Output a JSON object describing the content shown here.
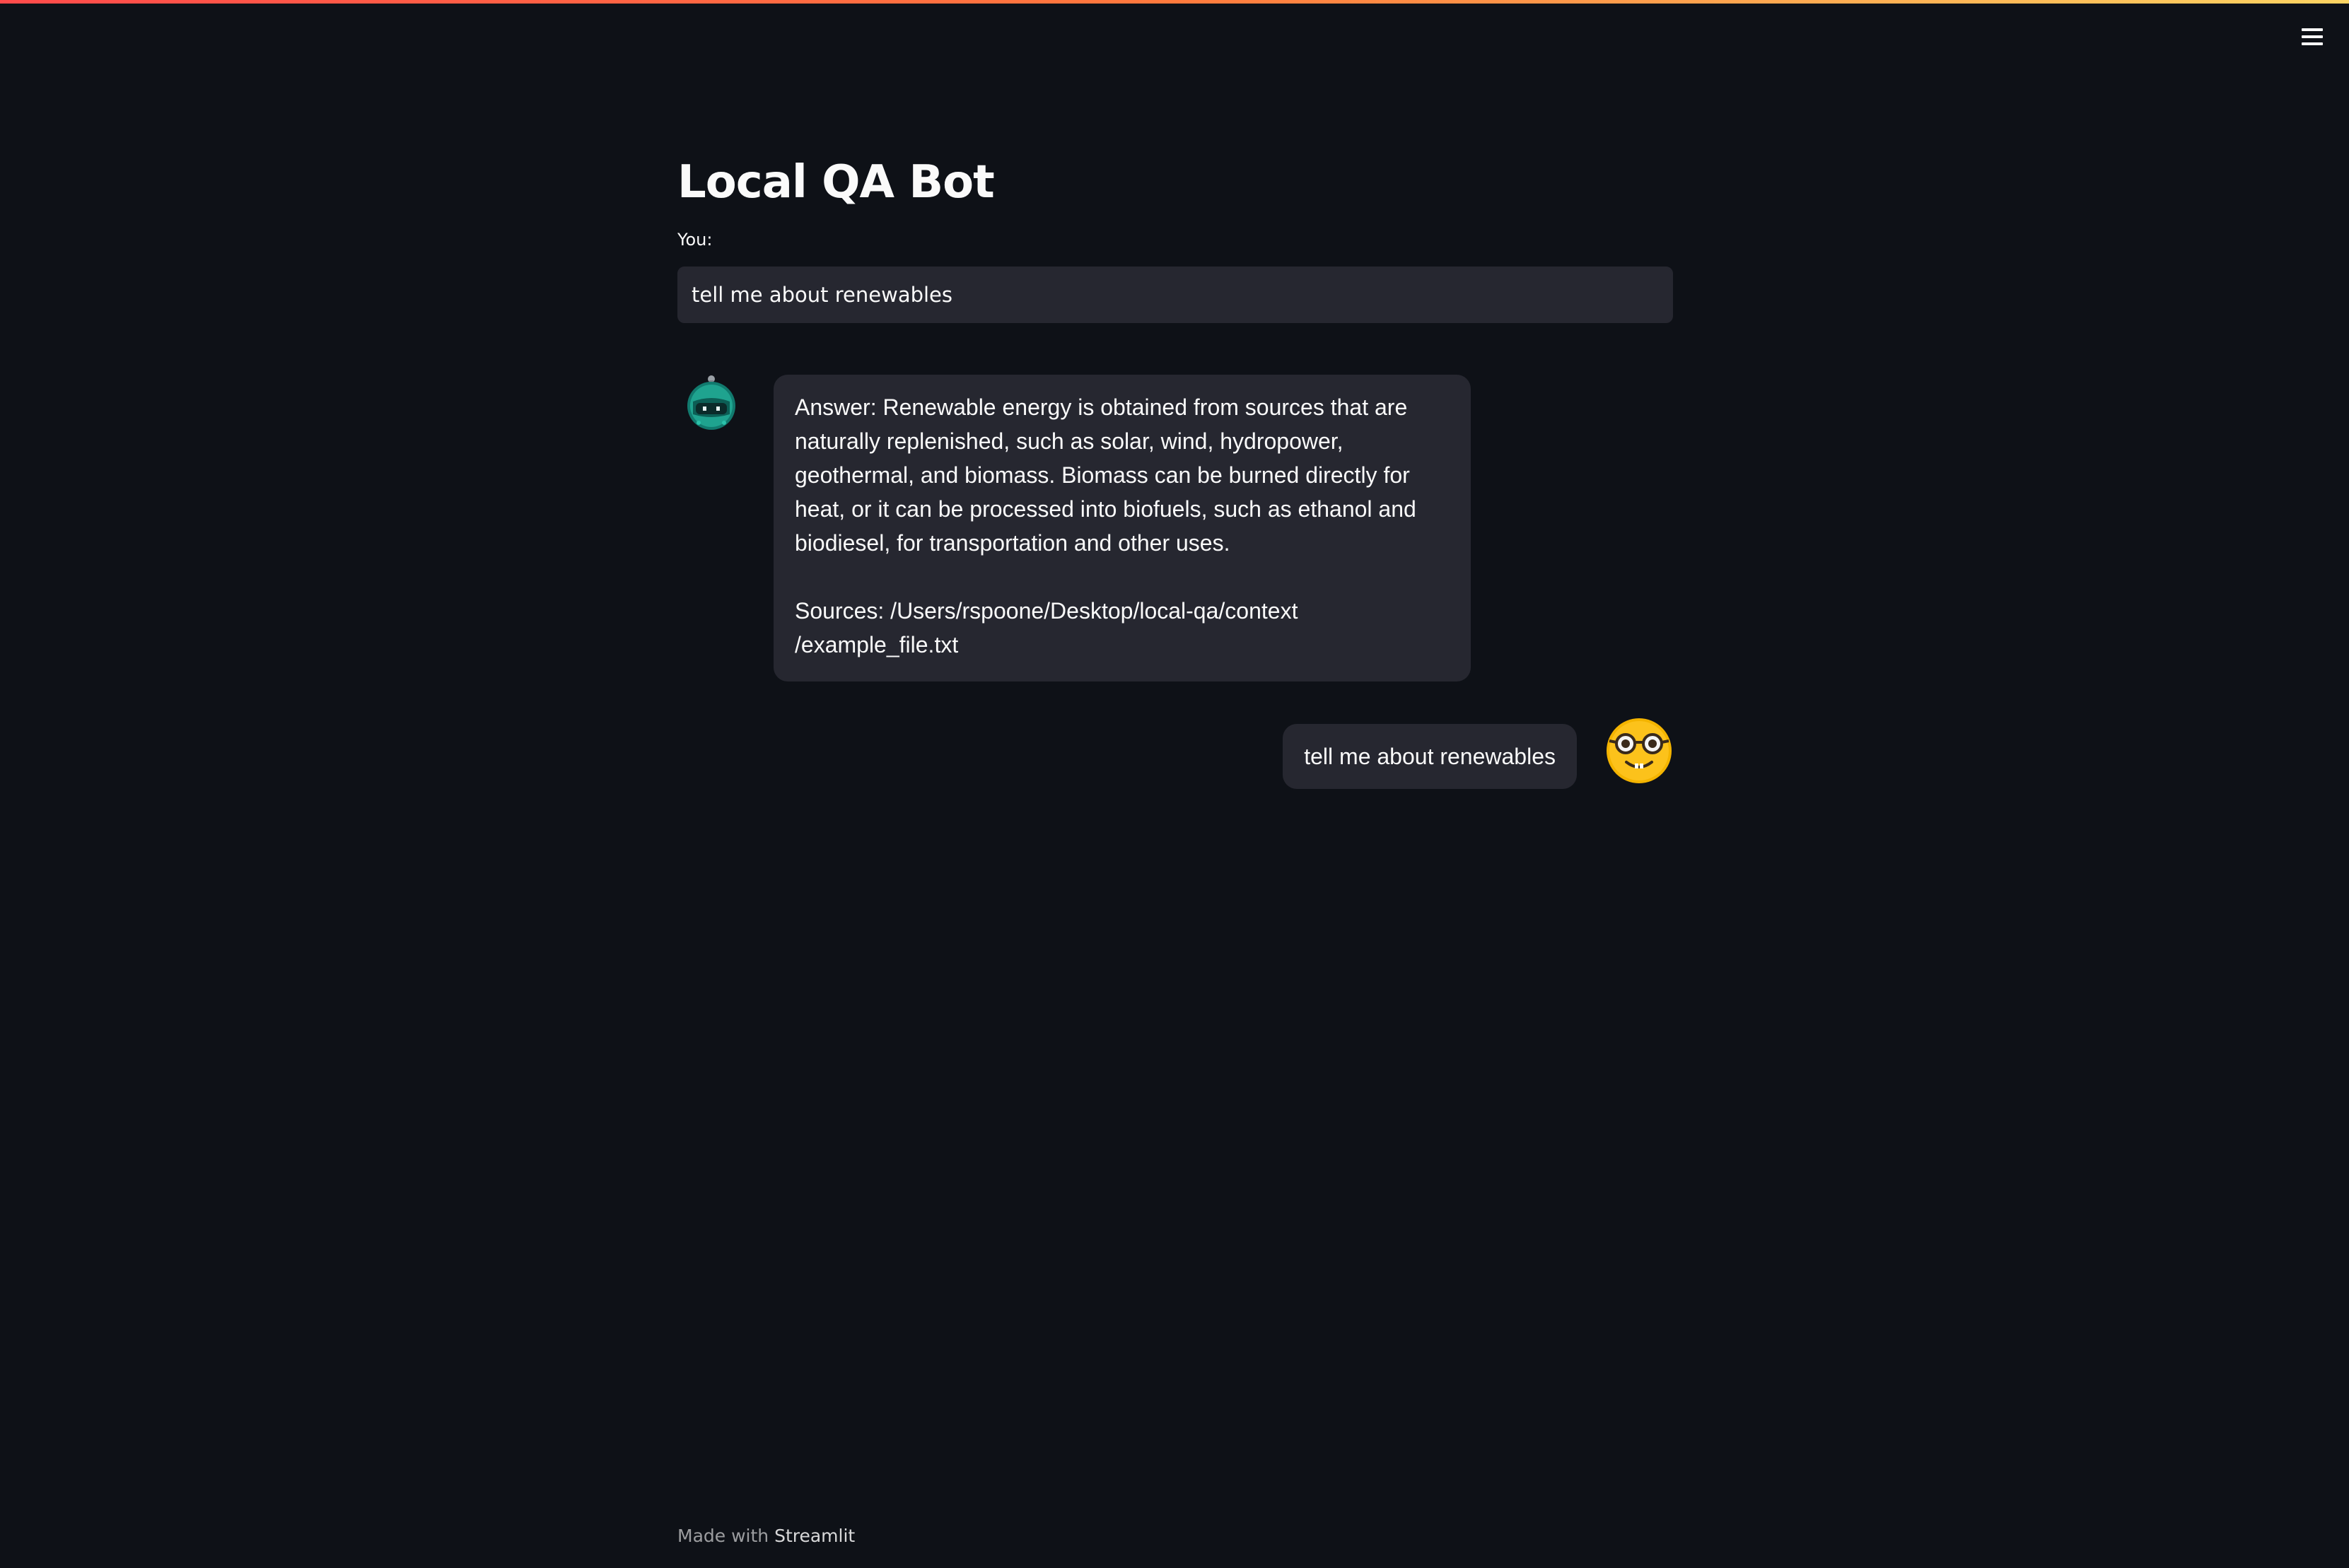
{
  "app": {
    "title": "Local QA Bot",
    "menu_icon": "hamburger-menu-icon"
  },
  "input": {
    "label": "You:",
    "value": "tell me about renewables"
  },
  "messages": {
    "bot": {
      "avatar_icon": "robot-avatar-icon",
      "answer": "Answer: Renewable energy is obtained from sources that are naturally replenished, such as solar, wind, hydropower, geothermal, and biomass. Biomass can be burned directly for heat, or it can be processed into biofuels, such as ethanol and biodiesel, for transportation and other uses.",
      "sources": "Sources: /Users/rspoone/Desktop/local-qa/context /example_file.txt"
    },
    "user": {
      "avatar_icon": "nerd-face-avatar-icon",
      "text": "tell me about renewables"
    }
  },
  "footer": {
    "prefix": "Made with ",
    "brand": "Streamlit"
  },
  "colors": {
    "background": "#0e1117",
    "surface": "#262730",
    "text": "#fafafa",
    "accent_gradient_start": "#ff4b4b",
    "accent_gradient_end": "#fdd462"
  }
}
